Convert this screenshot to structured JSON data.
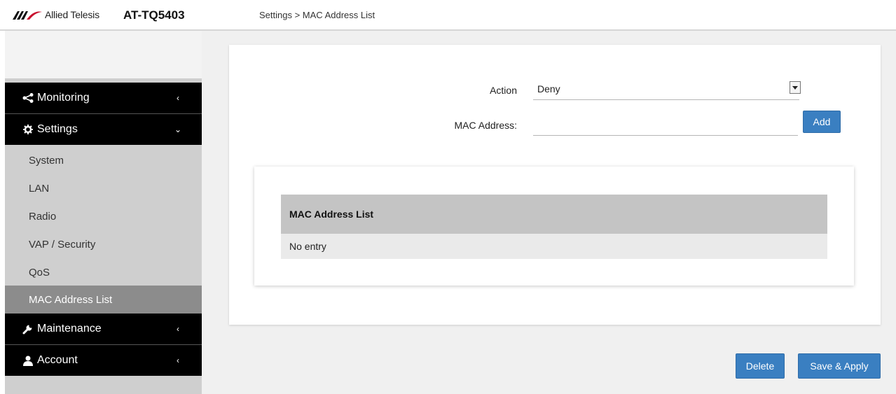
{
  "header": {
    "brand": "Allied Telesis",
    "model": "AT-TQ5403",
    "breadcrumb": "Settings > MAC Address List"
  },
  "sidebar": {
    "sections": [
      {
        "label": "Monitoring",
        "icon": "share-icon",
        "chevron": "‹"
      },
      {
        "label": "Settings",
        "icon": "gear-icon",
        "chevron": "⌄"
      },
      {
        "label": "Maintenance",
        "icon": "wrench-icon",
        "chevron": "‹"
      },
      {
        "label": "Account",
        "icon": "user-icon",
        "chevron": "‹"
      }
    ],
    "settings_items": [
      {
        "label": "System"
      },
      {
        "label": "LAN"
      },
      {
        "label": "Radio"
      },
      {
        "label": "VAP / Security"
      },
      {
        "label": "QoS"
      },
      {
        "label": "MAC Address List",
        "active": true
      }
    ]
  },
  "form": {
    "action_label": "Action",
    "action_value": "Deny",
    "mac_label": "MAC Address:",
    "mac_value": "",
    "add_label": "Add"
  },
  "mac_list": {
    "header": "MAC Address List",
    "empty_text": "No entry"
  },
  "footer": {
    "delete_label": "Delete",
    "save_label": "Save & Apply"
  },
  "colors": {
    "button": "#3a7fc1",
    "sidebar_head": "#000000",
    "sidebar_body": "#cfcfcf",
    "sidebar_active": "#8c8c8c",
    "logo_accent": "#c8102e"
  }
}
